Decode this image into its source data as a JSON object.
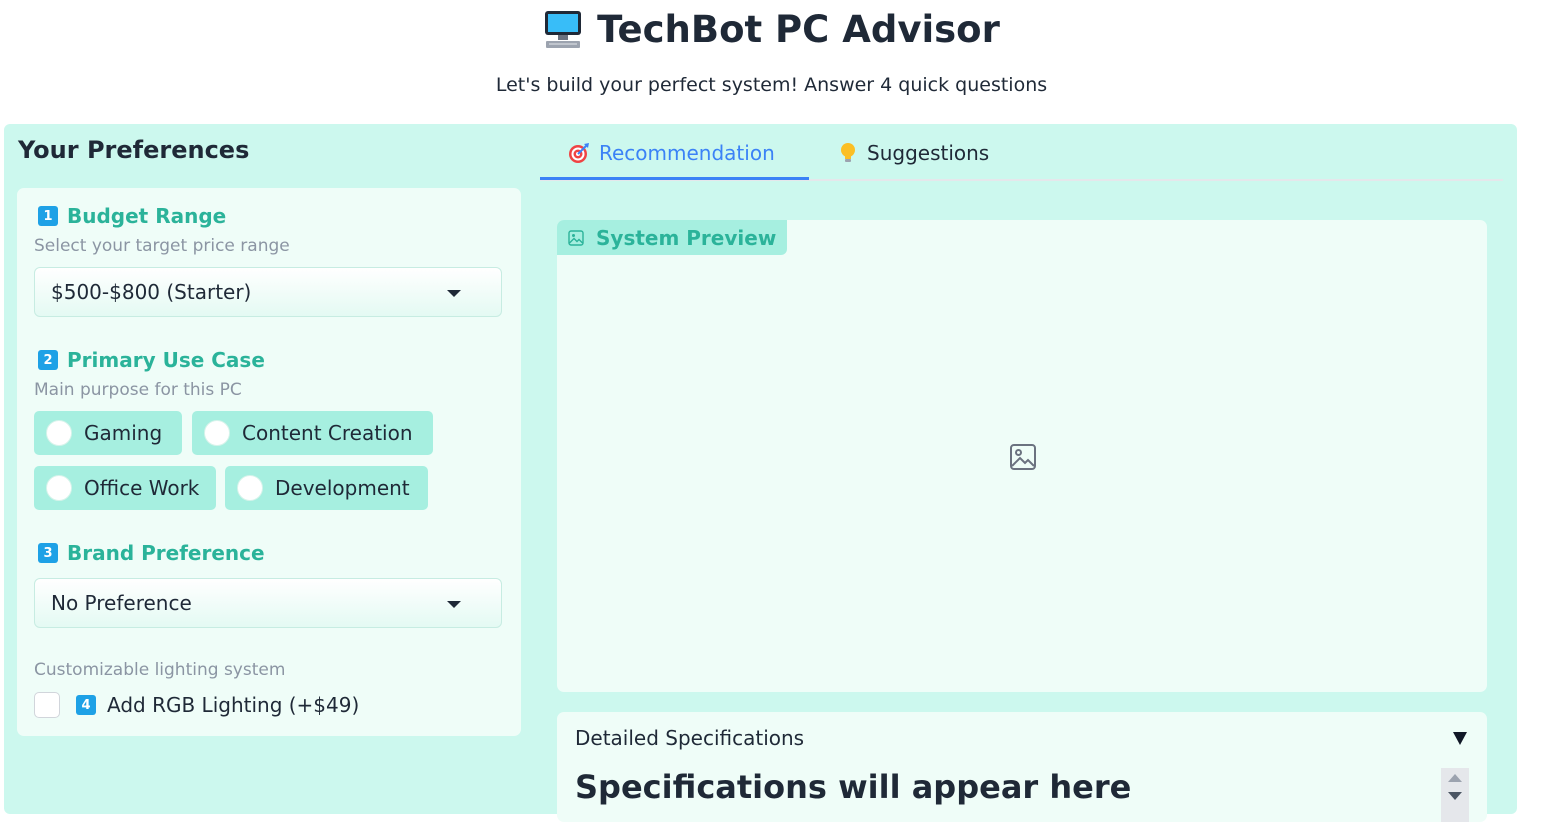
{
  "header": {
    "title": "TechBot PC Advisor",
    "title_icon": "desktop-computer-icon",
    "subtitle": "Let's build your perfect system! Answer 4 quick questions"
  },
  "preferences": {
    "heading": "Your Preferences",
    "budget": {
      "step": "1",
      "label": "Budget Range",
      "hint": "Select your target price range",
      "selected": "$500-$800 (Starter)"
    },
    "use_case": {
      "step": "2",
      "label": "Primary Use Case",
      "hint": "Main purpose for this PC",
      "options": [
        "Gaming",
        "Content Creation",
        "Office Work",
        "Development"
      ]
    },
    "brand": {
      "step": "3",
      "label": "Brand Preference",
      "selected": "No Preference"
    },
    "rgb": {
      "hint": "Customizable lighting system",
      "step": "4",
      "label": "Add RGB Lighting (+$49)",
      "checked": false
    }
  },
  "tabs": [
    {
      "label": "Recommendation",
      "icon": "target-icon",
      "active": true
    },
    {
      "label": "Suggestions",
      "icon": "lightbulb-icon",
      "active": false
    }
  ],
  "preview": {
    "label": "System Preview",
    "icon": "image-icon"
  },
  "specs": {
    "title": "Detailed Specifications",
    "placeholder": "Specifications will appear here"
  },
  "colors": {
    "accent_teal": "#2bb39a",
    "panel_bg": "#ccf8ee",
    "chip_bg": "#a6efe0",
    "step_badge": "#1ea1e6",
    "active_tab": "#3b82f6"
  }
}
